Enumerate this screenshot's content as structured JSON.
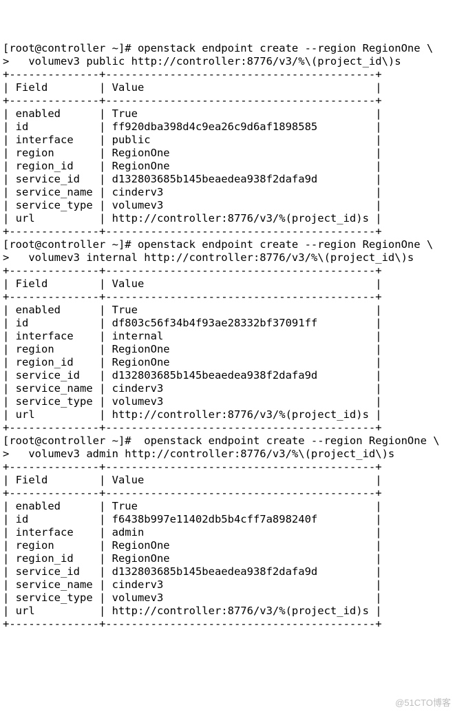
{
  "blocks": [
    {
      "cmd_line1": "[root@controller ~]# openstack endpoint create --region RegionOne \\",
      "cmd_line2": ">   volumev3 public http://controller:8776/v3/%\\(project_id\\)s",
      "field_header": "Field",
      "value_header": "Value",
      "rows": [
        {
          "field": "enabled",
          "value": "True"
        },
        {
          "field": "id",
          "value": "ff920dba398d4c9ea26c9d6af1898585"
        },
        {
          "field": "interface",
          "value": "public"
        },
        {
          "field": "region",
          "value": "RegionOne"
        },
        {
          "field": "region_id",
          "value": "RegionOne"
        },
        {
          "field": "service_id",
          "value": "d132803685b145beaedea938f2dafa9d"
        },
        {
          "field": "service_name",
          "value": "cinderv3"
        },
        {
          "field": "service_type",
          "value": "volumev3"
        },
        {
          "field": "url",
          "value": "http://controller:8776/v3/%(project_id)s"
        }
      ]
    },
    {
      "cmd_line1": "[root@controller ~]# openstack endpoint create --region RegionOne \\",
      "cmd_line2": ">   volumev3 internal http://controller:8776/v3/%\\(project_id\\)s",
      "field_header": "Field",
      "value_header": "Value",
      "rows": [
        {
          "field": "enabled",
          "value": "True"
        },
        {
          "field": "id",
          "value": "df803c56f34b4f93ae28332bf37091ff"
        },
        {
          "field": "interface",
          "value": "internal"
        },
        {
          "field": "region",
          "value": "RegionOne"
        },
        {
          "field": "region_id",
          "value": "RegionOne"
        },
        {
          "field": "service_id",
          "value": "d132803685b145beaedea938f2dafa9d"
        },
        {
          "field": "service_name",
          "value": "cinderv3"
        },
        {
          "field": "service_type",
          "value": "volumev3"
        },
        {
          "field": "url",
          "value": "http://controller:8776/v3/%(project_id)s"
        }
      ]
    },
    {
      "cmd_line1": "[root@controller ~]#  openstack endpoint create --region RegionOne \\",
      "cmd_line2": ">   volumev3 admin http://controller:8776/v3/%\\(project_id\\)s",
      "field_header": "Field",
      "value_header": "Value",
      "rows": [
        {
          "field": "enabled",
          "value": "True"
        },
        {
          "field": "id",
          "value": "f6438b997e11402db5b4cff7a898240f"
        },
        {
          "field": "interface",
          "value": "admin"
        },
        {
          "field": "region",
          "value": "RegionOne"
        },
        {
          "field": "region_id",
          "value": "RegionOne"
        },
        {
          "field": "service_id",
          "value": "d132803685b145beaedea938f2dafa9d"
        },
        {
          "field": "service_name",
          "value": "cinderv3"
        },
        {
          "field": "service_type",
          "value": "volumev3"
        },
        {
          "field": "url",
          "value": "http://controller:8776/v3/%(project_id)s"
        }
      ]
    }
  ],
  "col1_width": 14,
  "col2_width": 42,
  "watermark": "@51CTO博客"
}
